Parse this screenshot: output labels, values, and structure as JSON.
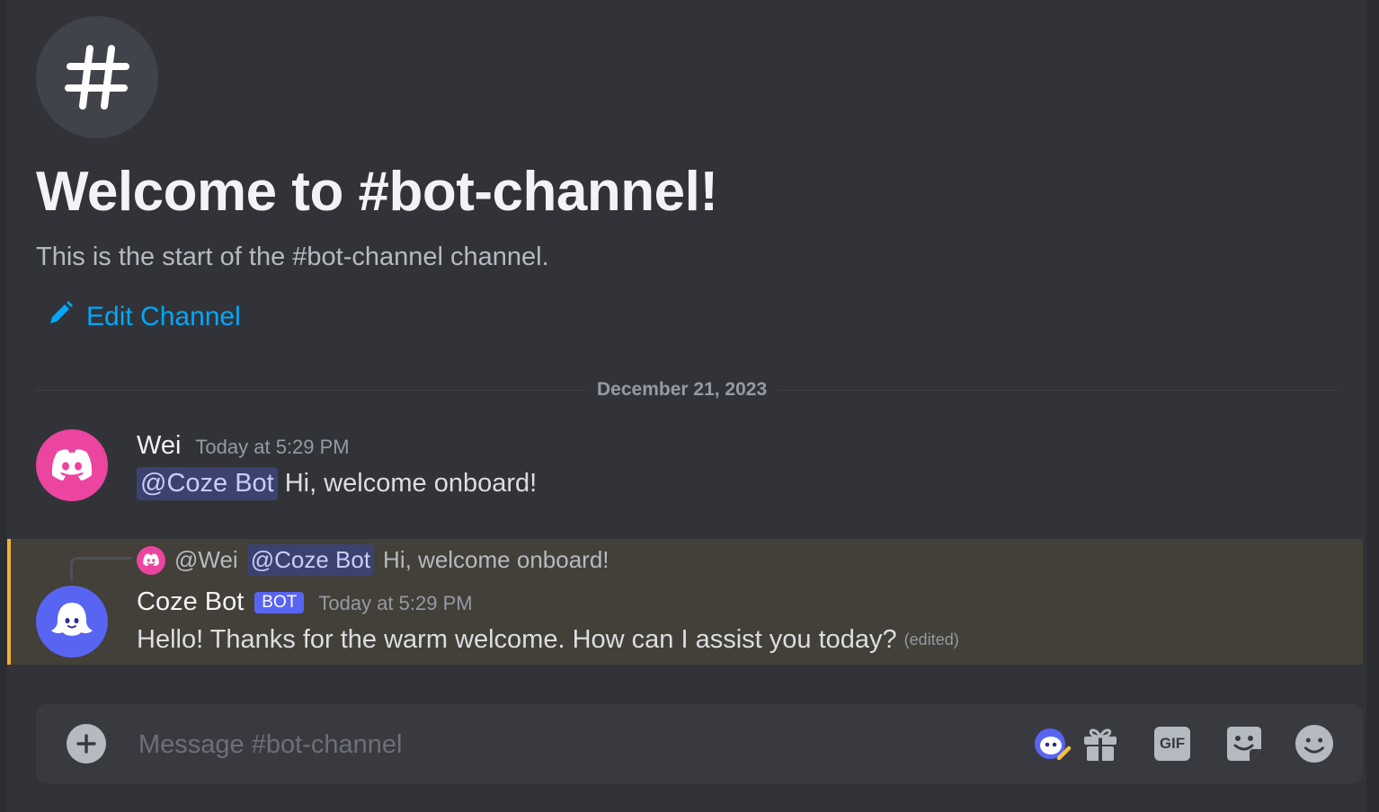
{
  "channel": {
    "welcome_title": "Welcome to #bot-channel!",
    "welcome_subtitle": "This is the start of the #bot-channel channel.",
    "edit_label": "Edit Channel",
    "icon": "hashtag-icon"
  },
  "divider": {
    "date": "December 21, 2023"
  },
  "messages": [
    {
      "author": "Wei",
      "timestamp": "Today at 5:29 PM",
      "mention": "@Coze Bot",
      "text": "Hi, welcome onboard!",
      "avatar_color": "#eb459f"
    },
    {
      "reply": {
        "author": "@Wei",
        "mention": "@Coze Bot",
        "text": "Hi, welcome onboard!"
      },
      "author": "Coze Bot",
      "badge": "BOT",
      "timestamp": "Today at 5:29 PM",
      "text": "Hello! Thanks for the warm welcome. How can I assist you today?",
      "edited": "(edited)",
      "avatar_color": "#5865f2"
    }
  ],
  "composer": {
    "placeholder": "Message #bot-channel",
    "gif_label": "GIF",
    "tools": [
      "coze-app-icon",
      "gift-icon",
      "gif-icon",
      "sticker-icon",
      "emoji-icon"
    ]
  },
  "colors": {
    "background": "#313338",
    "link": "#00a8fc",
    "mention_bg": "#3c4270",
    "highlight_bg": "#433f39",
    "highlight_border": "#f0b232",
    "bot_badge": "#5865f2"
  }
}
